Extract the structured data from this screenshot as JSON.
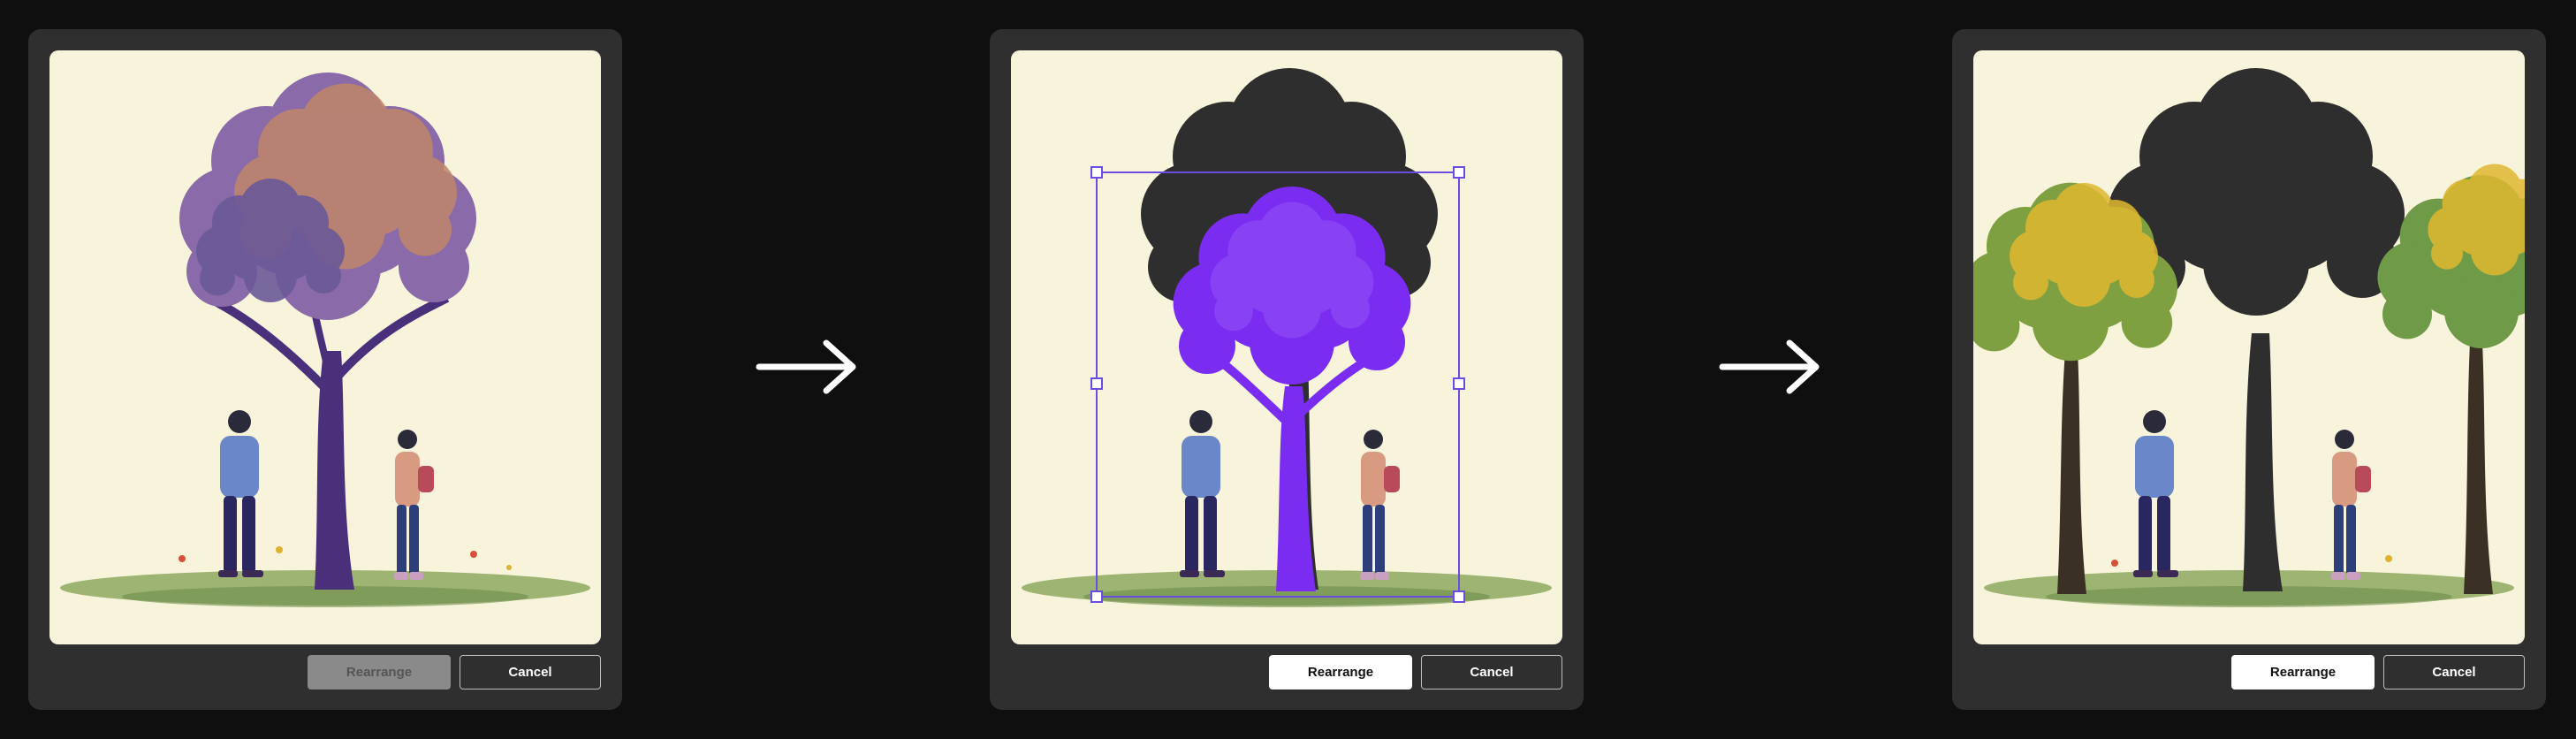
{
  "steps": [
    {
      "rearrange_label": "Rearrange",
      "cancel_label": "Cancel",
      "rearrange_state": "disabled"
    },
    {
      "rearrange_label": "Rearrange",
      "cancel_label": "Cancel",
      "rearrange_state": "enabled"
    },
    {
      "rearrange_label": "Rearrange",
      "cancel_label": "Cancel",
      "rearrange_state": "enabled"
    }
  ],
  "icons": [
    "arrow-right-icon",
    "arrow-right-icon"
  ],
  "colors": {
    "page_bg": "#0f0f0f",
    "panel_bg": "#2f2f2f",
    "canvas_bg": "#f8f4dc",
    "selection": "#6a4de0",
    "selected_tree": "#7a2cf0",
    "shadow_tree": "#2e2e2e"
  }
}
